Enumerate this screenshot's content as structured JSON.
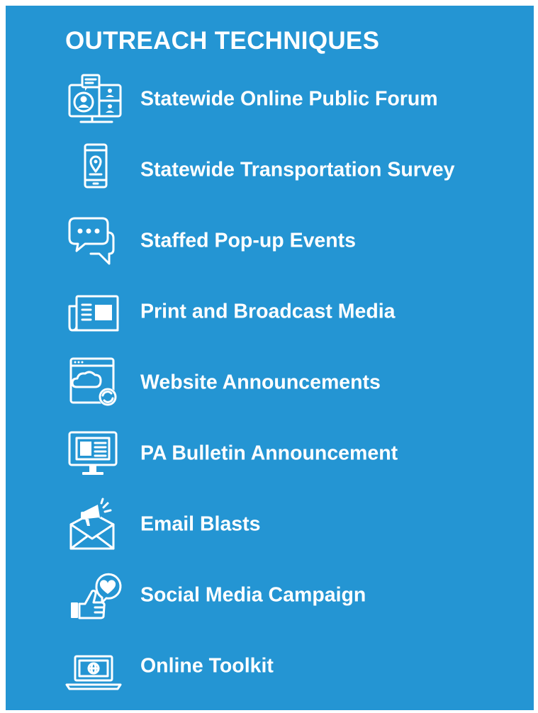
{
  "title": "OUTREACH TECHNIQUES",
  "colors": {
    "background": "#2495d3",
    "text": "#ffffff"
  },
  "items": [
    {
      "label": "Statewide Online Public Forum",
      "icon": "video-conference-icon"
    },
    {
      "label": "Statewide Transportation Survey",
      "icon": "mobile-location-icon"
    },
    {
      "label": "Staffed Pop-up Events",
      "icon": "chat-bubbles-icon"
    },
    {
      "label": "Print and Broadcast Media",
      "icon": "newspaper-icon"
    },
    {
      "label": "Website Announcements",
      "icon": "web-cloud-sync-icon"
    },
    {
      "label": "PA Bulletin Announcement",
      "icon": "monitor-document-icon"
    },
    {
      "label": "Email Blasts",
      "icon": "megaphone-envelope-icon"
    },
    {
      "label": "Social Media Campaign",
      "icon": "thumbs-up-heart-icon"
    },
    {
      "label": "Online Toolkit",
      "icon": "laptop-globe-icon"
    }
  ]
}
